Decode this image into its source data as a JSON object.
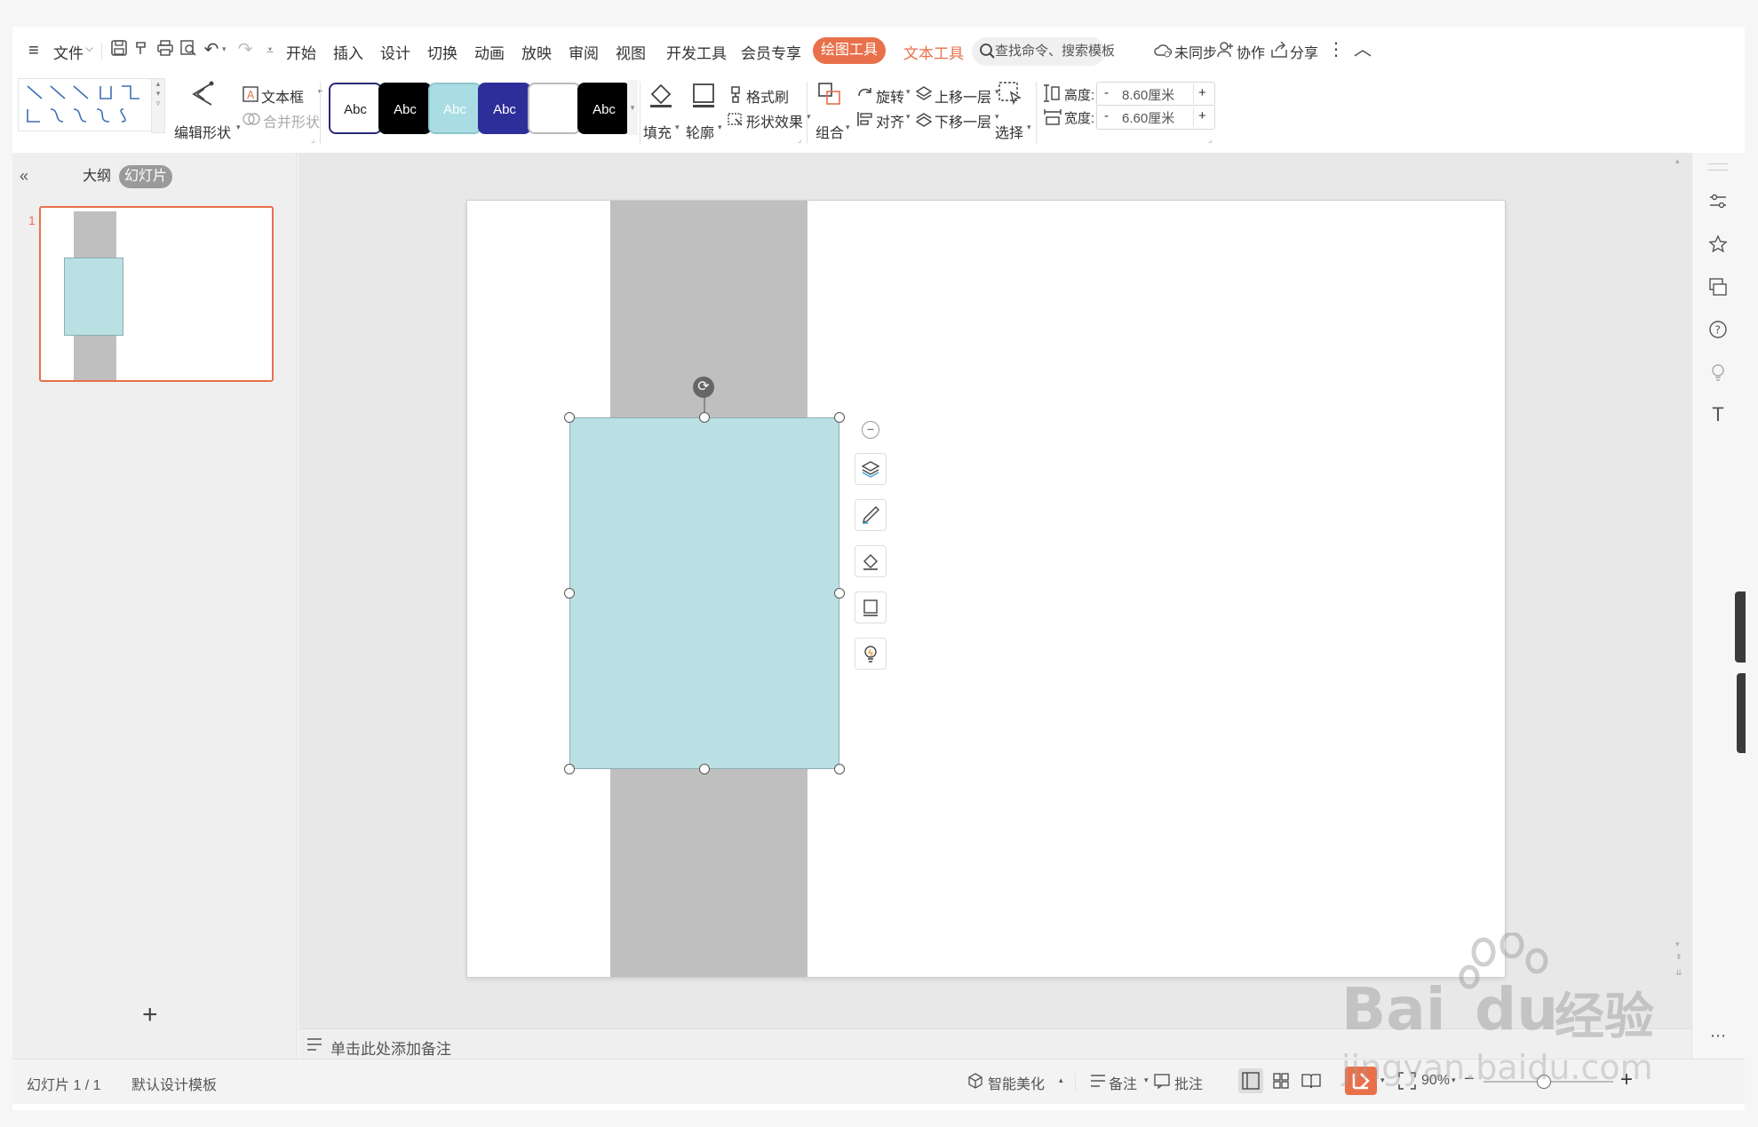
{
  "menubar": {
    "app_menu_label": "文件",
    "tabs": [
      "开始",
      "插入",
      "设计",
      "切换",
      "动画",
      "放映",
      "审阅",
      "视图",
      "开发工具",
      "会员专享"
    ],
    "drawing_tools_tab": "绘图工具",
    "text_tools_tab": "文本工具",
    "search_placeholder": "查找命令、搜索模板",
    "sync_label": "未同步",
    "collab_label": "协作",
    "share_label": "分享"
  },
  "ribbon": {
    "edit_shape": "编辑形状",
    "text_box": "文本框",
    "merge_shapes": "合并形状",
    "style_samples": [
      {
        "label": "Abc",
        "bg": "#ffffff",
        "fg": "#222222",
        "border": "#2a2a7a"
      },
      {
        "label": "Abc",
        "bg": "#000000",
        "fg": "#ffffff",
        "border": "#000000"
      },
      {
        "label": "Abc",
        "bg": "#a9dde3",
        "fg": "#ffffff",
        "border": "#8fc5cb"
      },
      {
        "label": "Abc",
        "bg": "#2e2e9a",
        "fg": "#ffffff",
        "border": "#2e2e9a"
      },
      {
        "label": "",
        "bg": "#ffffff",
        "fg": "#222222",
        "border": "#bbbbbb"
      },
      {
        "label": "Abc",
        "bg": "#000000",
        "fg": "#ffffff",
        "border": "#000000"
      }
    ],
    "fill": "填充",
    "outline": "轮廓",
    "format_painter": "格式刷",
    "shape_effects": "形状效果",
    "group": "组合",
    "rotate": "旋转",
    "align": "对齐",
    "bring_forward": "上移一层",
    "send_backward": "下移一层",
    "select": "选择",
    "height_label": "高度:",
    "height_value": "8.60厘米",
    "width_label": "宽度:",
    "width_value": "6.60厘米",
    "minus": "-",
    "plus": "+"
  },
  "leftpanel": {
    "outline_tab": "大纲",
    "slides_tab": "幻灯片",
    "slide_number": "1",
    "add_slide": "+"
  },
  "workspace": {
    "notes_placeholder": "单击此处添加备注"
  },
  "colors": {
    "accent": "#e8704a",
    "gray_bar": "#bfbfbf",
    "shape_fill": "#bbe0e3",
    "shape_stroke": "#8aaeb2"
  },
  "statusbar": {
    "slide_counter": "幻灯片 1 / 1",
    "template": "默认设计模板",
    "smart_beautify": "智能美化",
    "notes": "备注",
    "comments": "批注",
    "zoom": "90%",
    "zoom_minus": "−",
    "zoom_plus": "+"
  },
  "watermark": {
    "brand": "Bai",
    "brand_du": "du",
    "brand_cn": "经验",
    "url": "jingyan.baidu.com"
  }
}
